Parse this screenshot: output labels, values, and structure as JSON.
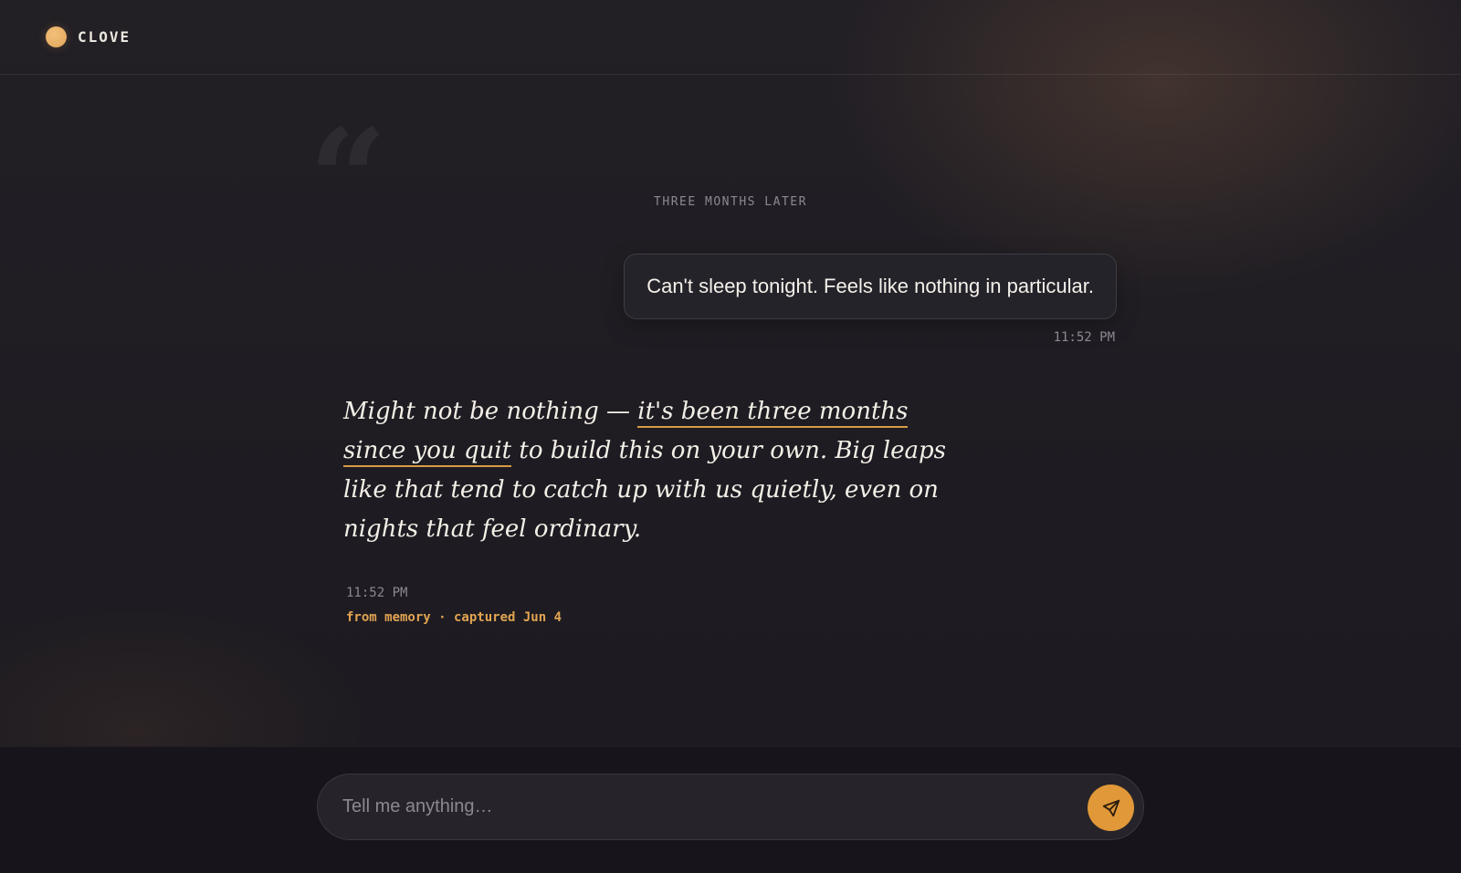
{
  "app": {
    "name": "CLOVE"
  },
  "conversation": {
    "divider_label": "THREE MONTHS LATER",
    "user_message": {
      "text": "Can't sleep tonight. Feels like nothing in particular.",
      "time": "11:52 PM"
    },
    "assistant_message": {
      "text_before": "Might not be nothing — ",
      "highlight": "it's been three months since you quit",
      "text_after": " to build this on your own. Big leaps like that tend to catch up with us quietly, even on nights that feel ordinary.",
      "time": "11:52 PM",
      "memory_tag": "from memory · captured Jun 4"
    }
  },
  "composer": {
    "placeholder": "Tell me anything…",
    "value": "",
    "send_icon": "send-icon"
  },
  "colors": {
    "accent": "#e09838",
    "background": "#1d1b21",
    "footer": "#17151b",
    "muted_text": "#8d8894"
  }
}
